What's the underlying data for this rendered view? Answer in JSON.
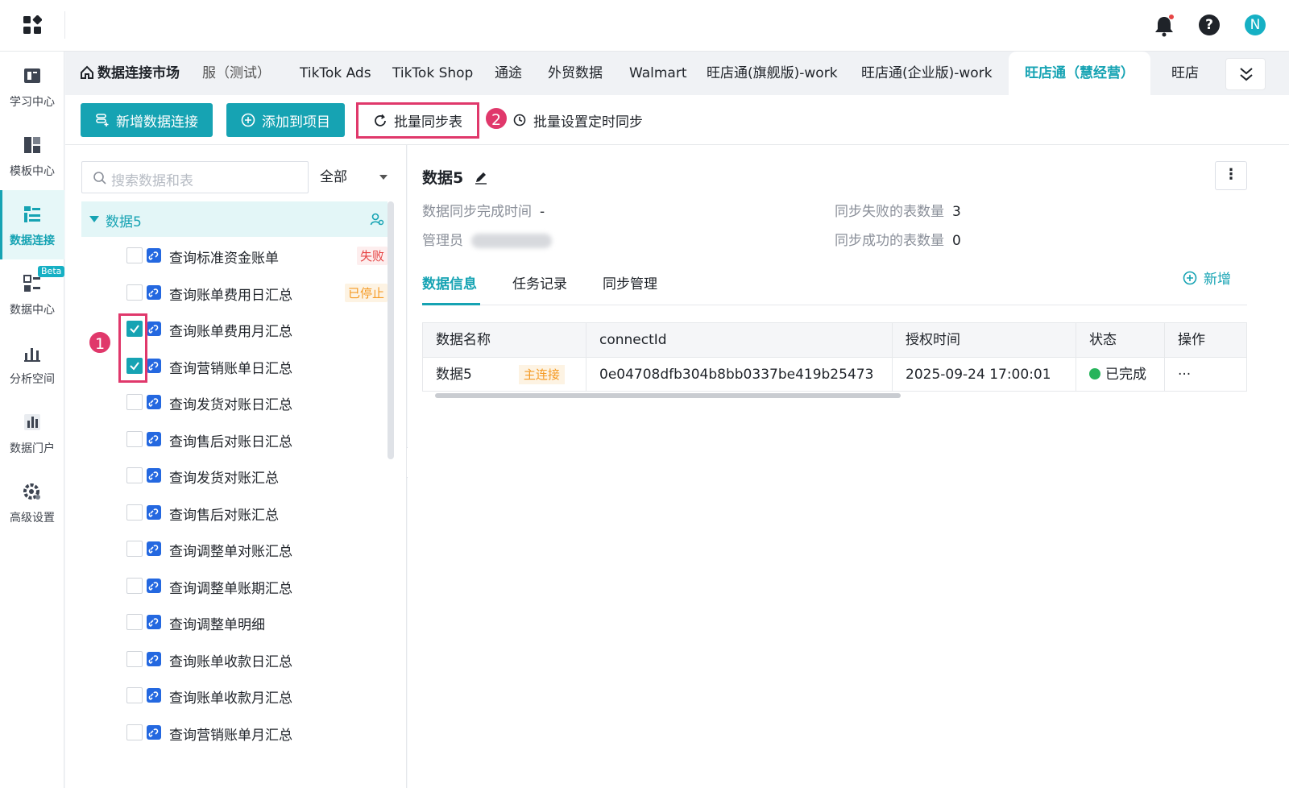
{
  "header": {
    "notification_dot_color": "#e64545",
    "help_glyph": "?",
    "avatar_initial": "N"
  },
  "sidebar": {
    "items": [
      {
        "label": "学习中心",
        "icon": "book-icon"
      },
      {
        "label": "模板中心",
        "icon": "template-icon"
      },
      {
        "label": "数据连接",
        "icon": "data-connect-icon",
        "active": true
      },
      {
        "label": "数据中心",
        "icon": "data-center-icon",
        "badge": "Beta"
      },
      {
        "label": "分析空间",
        "icon": "analysis-icon"
      },
      {
        "label": "数据门户",
        "icon": "portal-icon"
      },
      {
        "label": "高级设置",
        "icon": "gear-icon"
      }
    ]
  },
  "tabs": [
    {
      "label": "数据连接市场"
    },
    {
      "label": "服（测试）"
    },
    {
      "label": "TikTok Ads"
    },
    {
      "label": "TikTok Shop"
    },
    {
      "label": "通途"
    },
    {
      "label": "外贸数据"
    },
    {
      "label": "Walmart"
    },
    {
      "label": "旺店通(旗舰版)-work"
    },
    {
      "label": "旺店通(企业版)-work"
    },
    {
      "label": "旺店通（慧经营）",
      "active": true
    },
    {
      "label": "旺店"
    }
  ],
  "toolbar": {
    "add_connection": "新增数据连接",
    "add_to_project": "添加到项目",
    "batch_sync": "批量同步表",
    "batch_schedule": "批量设置定时同步",
    "step1": "1",
    "step2": "2"
  },
  "left": {
    "search_placeholder": "搜索数据和表",
    "filter_value": "全部",
    "root_name": "数据5",
    "tables": [
      {
        "name": "查询标准资金账单",
        "checked": false,
        "tag": "失败",
        "tag_type": "fail"
      },
      {
        "name": "查询账单费用日汇总",
        "checked": false,
        "tag": "已停止",
        "tag_type": "stop"
      },
      {
        "name": "查询账单费用月汇总",
        "checked": true
      },
      {
        "name": "查询营销账单日汇总",
        "checked": true
      },
      {
        "name": "查询发货对账日汇总",
        "checked": false
      },
      {
        "name": "查询售后对账日汇总",
        "checked": false
      },
      {
        "name": "查询发货对账汇总",
        "checked": false
      },
      {
        "name": "查询售后对账汇总",
        "checked": false
      },
      {
        "name": "查询调整单对账汇总",
        "checked": false
      },
      {
        "name": "查询调整单账期汇总",
        "checked": false
      },
      {
        "name": "查询调整单明细",
        "checked": false
      },
      {
        "name": "查询账单收款日汇总",
        "checked": false
      },
      {
        "name": "查询账单收款月汇总",
        "checked": false
      },
      {
        "name": "查询营销账单月汇总",
        "checked": false
      }
    ]
  },
  "detail": {
    "title": "数据5",
    "sync_time_label": "数据同步完成时间",
    "sync_time_value": "-",
    "admin_label": "管理员",
    "fail_count_label": "同步失败的表数量",
    "fail_count_value": "3",
    "success_count_label": "同步成功的表数量",
    "success_count_value": "0",
    "tabs": [
      "数据信息",
      "任务记录",
      "同步管理"
    ],
    "add_label": "新增",
    "columns": [
      "数据名称",
      "connectId",
      "授权时间",
      "状态",
      "操作"
    ],
    "row": {
      "name": "数据5",
      "main_tag": "主连接",
      "connect_id": "0e04708dfb304b8bb0337be419b25473",
      "auth_time": "2025-09-24 17:00:01",
      "status": "已完成",
      "action": "···"
    }
  },
  "colors": {
    "accent": "#16a3b3",
    "highlight": "#e0386b",
    "fail": "#e64545",
    "stop": "#f59a23",
    "success": "#27b45b"
  }
}
